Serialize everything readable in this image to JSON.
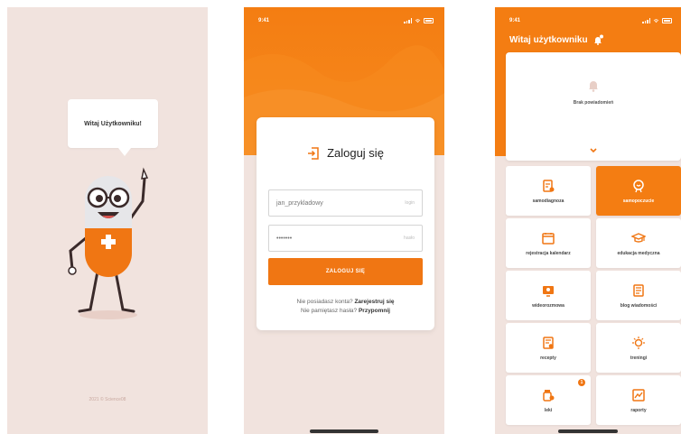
{
  "colors": {
    "accent": "#f07613",
    "background": "#f1e3de"
  },
  "splash": {
    "greeting": "Witaj Użytkowniku!",
    "copyright": "2021 © Science08"
  },
  "login": {
    "status_time": "9:41",
    "title": "Zaloguj się",
    "username": {
      "value": "jan_przykladowy",
      "placeholder": "login"
    },
    "password": {
      "value": "•••••••",
      "placeholder": "hasło"
    },
    "submit_label": "ZALOGUJ SIĘ",
    "no_account_text": "Nie posiadasz konta?",
    "register_link": "Zarejestruj się",
    "forgot_text": "Nie pamiętasz hasła?",
    "remind_link": "Przypomnij"
  },
  "home": {
    "status_time": "9:41",
    "welcome": "Witaj użytkowniku",
    "no_notifications": "Brak powiadomień",
    "tiles": [
      {
        "label": "samodiagnoza",
        "icon": "self-diagnosis-icon"
      },
      {
        "label": "samopoczucie",
        "icon": "mood-icon",
        "active": true
      },
      {
        "label": "rejestracja kalendarz",
        "icon": "calendar-icon"
      },
      {
        "label": "edukacja medyczna",
        "icon": "graduation-cap-icon"
      },
      {
        "label": "wideorozmowa",
        "icon": "video-call-icon"
      },
      {
        "label": "blog wiadomości",
        "icon": "blog-icon"
      },
      {
        "label": "recepty",
        "icon": "prescription-icon"
      },
      {
        "label": "treningi",
        "icon": "training-icon"
      },
      {
        "label": "leki",
        "icon": "medicine-icon",
        "badge": "1"
      },
      {
        "label": "raporty",
        "icon": "report-icon"
      }
    ]
  }
}
